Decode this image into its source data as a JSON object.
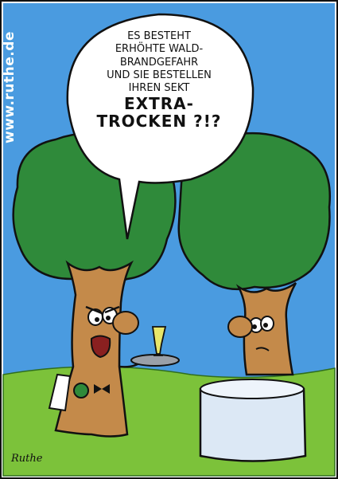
{
  "watermark": "www.ruthe.de",
  "speech": {
    "lines": [
      "Es besteht",
      "erhöhte Wald-",
      "brandgefahr",
      "und Sie bestellen",
      "Ihren Sekt"
    ],
    "emphasis": [
      "EXTRA-",
      "TROCKEN ?!?"
    ]
  },
  "signature": "Ruthe",
  "colors": {
    "sky": "#4a9be0",
    "grass": "#7cc23a",
    "foliage": "#2f8a3a",
    "trunk": "#c48a4a",
    "tablecloth": "#dce8f5"
  }
}
